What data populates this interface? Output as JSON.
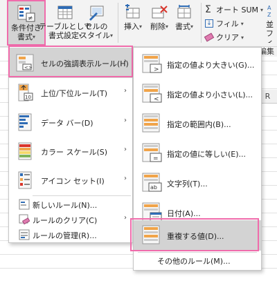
{
  "ribbon": {
    "conditional_format_line1": "条件付き",
    "conditional_format_line2": "書式",
    "table_format_line1": "テーブルとして",
    "table_format_line2": "書式設定",
    "cell_style_line1": "セルの",
    "cell_style_line2": "スタイル",
    "insert": "挿入",
    "delete": "削除",
    "format": "書式",
    "autosum": "オート SUM",
    "fill": "フィル",
    "clear": "クリア",
    "sort_partial_line1": "並",
    "sort_partial_line2": "フィ",
    "edit_partial": "編集"
  },
  "sheet": {
    "column_r": "R"
  },
  "main_menu": [
    {
      "label": "セルの強調表示ルール(H)",
      "submenu": true,
      "highlighted": true,
      "icon": "highlight-cells-rules-icon"
    },
    {
      "label": "上位/下位ルール(T)",
      "submenu": true,
      "highlighted": false,
      "icon": "top-bottom-rules-icon"
    },
    {
      "label": "データ バー(D)",
      "submenu": true,
      "highlighted": false,
      "icon": "data-bars-icon"
    },
    {
      "label": "カラー スケール(S)",
      "submenu": true,
      "highlighted": false,
      "icon": "color-scales-icon"
    },
    {
      "label": "アイコン セット(I)",
      "submenu": true,
      "highlighted": false,
      "icon": "icon-sets-icon"
    },
    {
      "label": "新しいルール(N)...",
      "submenu": false,
      "highlighted": false,
      "icon": "new-rule-icon"
    },
    {
      "label": "ルールのクリア(C)",
      "submenu": true,
      "highlighted": false,
      "icon": "clear-rules-icon"
    },
    {
      "label": "ルールの管理(R)...",
      "submenu": false,
      "highlighted": false,
      "icon": "manage-rules-icon"
    }
  ],
  "sub_menu": [
    {
      "label": "指定の値より大きい(G)...",
      "highlighted": false,
      "icon": "greater-than-icon",
      "glyph": ">"
    },
    {
      "label": "指定の値より小さい(L)...",
      "highlighted": false,
      "icon": "less-than-icon",
      "glyph": "<"
    },
    {
      "label": "指定の範囲内(B)...",
      "highlighted": false,
      "icon": "between-icon",
      "glyph": ""
    },
    {
      "label": "指定の値に等しい(E)...",
      "highlighted": false,
      "icon": "equal-to-icon",
      "glyph": "="
    },
    {
      "label": "文字列(T)...",
      "highlighted": false,
      "icon": "text-contains-icon",
      "glyph": "ab"
    },
    {
      "label": "日付(A)...",
      "highlighted": false,
      "icon": "date-occurring-icon",
      "glyph": ""
    },
    {
      "label": "重複する値(D)...",
      "highlighted": true,
      "icon": "duplicate-values-icon",
      "glyph": ""
    }
  ],
  "sub_menu_footer": "その他のルール(M)...",
  "colors": {
    "highlight_outline": "#f06bab",
    "highlight_bg": "#d3d3d3",
    "icon_blue": "#2f6cb5",
    "icon_orange": "#f0a44a",
    "icon_red": "#d9342b"
  }
}
